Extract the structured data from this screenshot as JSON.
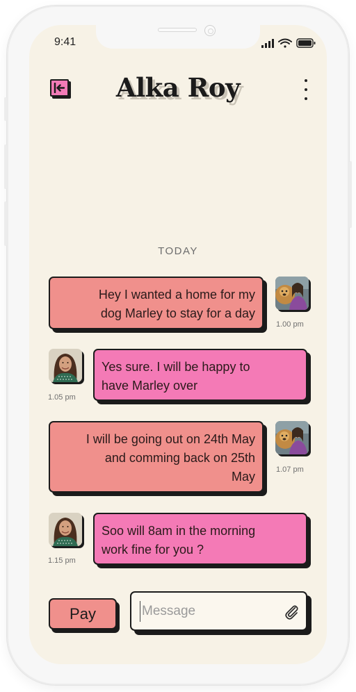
{
  "status_bar": {
    "time": "9:41"
  },
  "header": {
    "title": "Alka Roy"
  },
  "chat": {
    "date_divider": "TODAY",
    "messages": [
      {
        "direction": "sent",
        "text": [
          "Hey I wanted a home for my",
          "dog Marley to stay for a day"
        ],
        "time": "1.00 pm"
      },
      {
        "direction": "received",
        "text": [
          "Yes sure. I will be happy to",
          "have Marley over"
        ],
        "time": "1.05 pm"
      },
      {
        "direction": "sent",
        "text": [
          "I will be going out on 24th May",
          "and comming back on 25th",
          "May"
        ],
        "time": "1.07 pm"
      },
      {
        "direction": "received",
        "text": [
          "Soo will 8am in the morning",
          "work fine for you ?"
        ],
        "time": "1.15 pm"
      }
    ]
  },
  "composer": {
    "pay_label": "Pay",
    "message_placeholder": "Message"
  },
  "icons": {
    "back": "arrow-left-icon",
    "menu": "more-vertical-icon",
    "attach": "paperclip-icon"
  },
  "colors": {
    "background": "#f7f2e6",
    "sent_bubble": "#f0908c",
    "received_bubble": "#f47ab6",
    "outline": "#1b1b1b"
  }
}
